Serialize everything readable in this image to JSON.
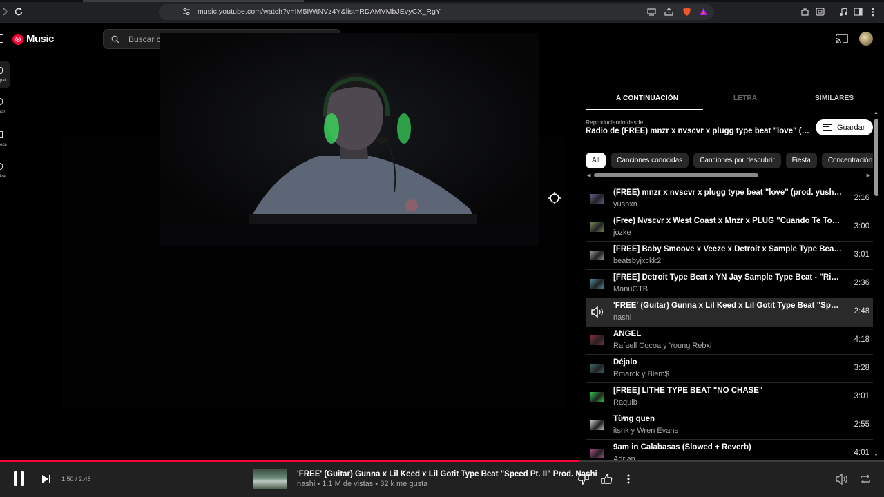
{
  "browser": {
    "url": "music.youtube.com/watch?v=IM5IWtNVz4Y&list=RDAMVMbJEvyCX_RgY"
  },
  "app": {
    "logo_text": "Music",
    "search_placeholder": "Buscar c"
  },
  "rail": [
    {
      "label": "pal"
    },
    {
      "label": "rar"
    },
    {
      "label": "eca"
    },
    {
      "label": "izar"
    }
  ],
  "panel": {
    "tabs": [
      "A CONTINUACIÓN",
      "LETRA",
      "SIMILARES"
    ],
    "active_tab": "A CONTINUACIÓN",
    "playing_from_label": "Reproduciendo desde",
    "radio_title": "Radio de (FREE) mnzr x nvscvr x plugg type beat \"love\" (prod. y...",
    "save_label": "Guardar",
    "chips": [
      "All",
      "Canciones conocidas",
      "Canciones por descubrir",
      "Fiesta",
      "Concentración"
    ],
    "active_chip": "All"
  },
  "queue": [
    {
      "title": "(FREE) mnzr x nvscvr x plugg type beat \"love\" (prod. yushxn)",
      "artist": "yushxn",
      "duration": "2:16",
      "thumb": "#6a5a8a"
    },
    {
      "title": "(Free) Nvscvr x West Coast x Mnzr x PLUG \"Cuando Te Toque\" |...",
      "artist": "jozke",
      "duration": "3:00",
      "thumb": "#6e8a55"
    },
    {
      "title": "[FREE] Baby Smoove x Veeze x Detroit x Sample Type Beat \"Blu...",
      "artist": "beatsbyjxckk2",
      "duration": "3:01",
      "thumb": "#9a9a9a"
    },
    {
      "title": "[FREE] Detroit Type Beat x YN Jay Sample Type Beat - \"Rio De J...",
      "artist": "ManuGTB",
      "duration": "2:36",
      "thumb": "#4a8aa0"
    },
    {
      "title": "'FREE' (Guitar) Gunna x Lil Keed x Lil Gotit Type Beat \"Speed Pt...",
      "artist": "nashi",
      "duration": "2:48",
      "thumb": "",
      "current": true
    },
    {
      "title": "ÁNGEL",
      "artist": "Rafaell Cocoa y Young Rebxl",
      "duration": "4:18",
      "thumb": "#8a2a3a"
    },
    {
      "title": "Déjalo",
      "artist": "Rmarck y Blem$",
      "duration": "3:28",
      "thumb": "#3a6a6a"
    },
    {
      "title": "[FREE] LITHE TYPE BEAT \"NO CHASE\"",
      "artist": "Raquib",
      "duration": "3:01",
      "thumb": "#2ec44a"
    },
    {
      "title": "Từng quen",
      "artist": "itsnk y Wren Evans",
      "duration": "2:55",
      "thumb": "#c8c8d0"
    },
    {
      "title": "9am in Calabasas (Slowed + Reverb)",
      "artist": "Adrian",
      "duration": "4:01",
      "thumb": "#b04a8a"
    }
  ],
  "player": {
    "time": "1:50 / 2:48",
    "progress": 0.655,
    "title": "'FREE' (Guitar) Gunna x Lil Keed x Lil Gotit Type Beat \"Speed Pt. II\" Prod. Nashi",
    "subtitle": "nashi • 1.1 M de vistas • 32 k me gusta"
  },
  "colors": {
    "brand_red": "#ff0033",
    "panel_bg": "#000000",
    "player_bg": "#212121"
  }
}
